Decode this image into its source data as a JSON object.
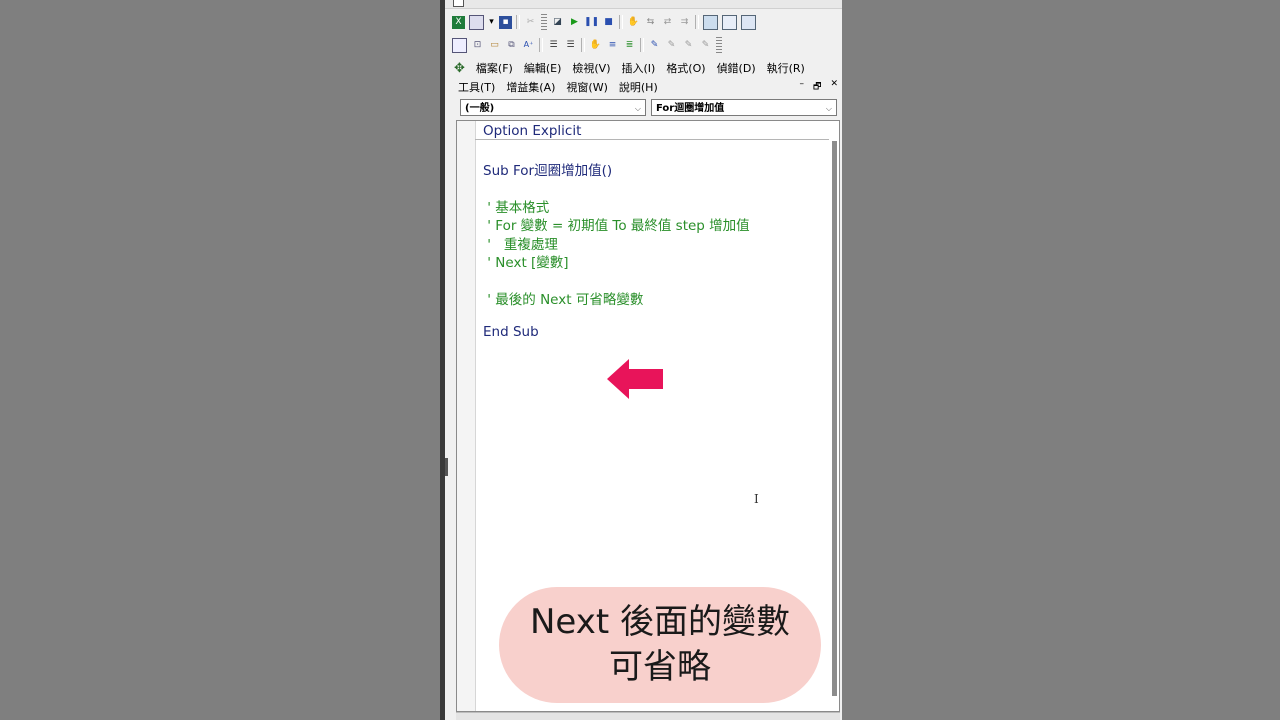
{
  "toolbar1": {
    "icons": [
      "excel-icon",
      "insert-userform-icon",
      "dropdown-arrow-icon",
      "save-icon",
      "cut-icon",
      "design-mode-icon",
      "run-icon",
      "break-icon",
      "reset-icon",
      "object-browser-icon",
      "properties-icon",
      "project-explorer-icon",
      "toolbox-icon",
      "userform-icon",
      "immediate-window-icon"
    ]
  },
  "toolbar2": {
    "icons": [
      "list-properties-icon",
      "list-constants-icon",
      "quick-info-icon",
      "parameter-info-icon",
      "complete-word-icon",
      "indent-icon",
      "outdent-icon",
      "toggle-breakpoint-icon",
      "comment-block-icon",
      "uncomment-block-icon",
      "toggle-bookmark-icon",
      "next-bookmark-icon",
      "prev-bookmark-icon",
      "clear-bookmarks-icon"
    ]
  },
  "menu": {
    "row1": [
      "檔案(F)",
      "編輯(E)",
      "檢視(V)",
      "插入(I)",
      "格式(O)",
      "偵錯(D)",
      "執行(R)"
    ],
    "row2": [
      "工具(T)",
      "增益集(A)",
      "視窗(W)",
      "說明(H)"
    ],
    "window_controls": [
      "–",
      "🗗",
      "✕"
    ]
  },
  "combos": {
    "object": "(一般)",
    "procedure": "For迴圈增加值"
  },
  "code": {
    "option": "Option Explicit",
    "sub_start": "Sub For迴圈增加值()",
    "c1": " ' 基本格式",
    "c2": " ' For 變數 = 初期值 To 最終值 step 增加值",
    "c3": " '   重複處理",
    "c4": " ' Next [變數]",
    "c5": " ' 最後的 Next 可省略變數",
    "sub_end": "End Sub"
  },
  "annotation": {
    "line1": "Next 後面的變數",
    "line2": "可省略",
    "arrow_color": "#e8145a",
    "bubble_color": "#f8d0cc"
  }
}
